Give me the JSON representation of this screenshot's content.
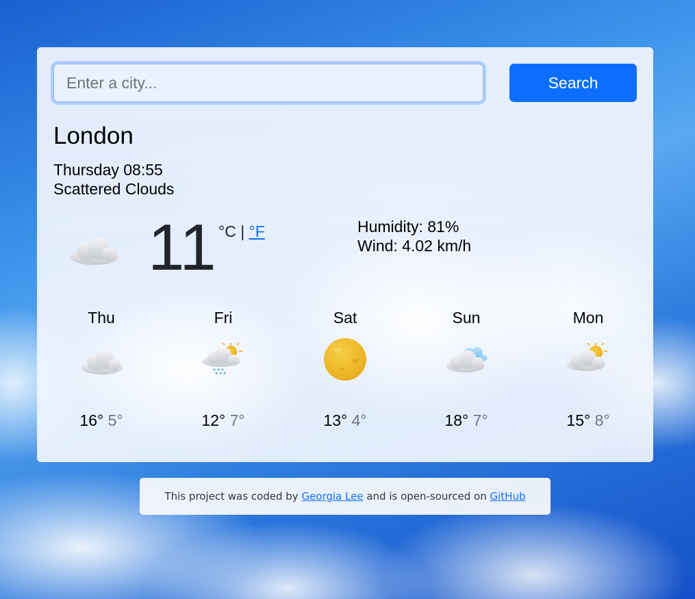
{
  "search": {
    "placeholder": "Enter a city...",
    "button_label": "Search"
  },
  "current": {
    "city": "London",
    "datetime": "Thursday 08:55",
    "description": "Scattered Clouds",
    "icon": "cloud-icon",
    "temperature": "11",
    "unit_celsius": "°C",
    "unit_separator": " | ",
    "unit_fahrenheit": "°F",
    "humidity": "Humidity: 81%",
    "wind": "Wind: 4.02 km/h"
  },
  "forecast": [
    {
      "day": "Thu",
      "icon": "cloud-icon",
      "max": "16°",
      "min": "5°"
    },
    {
      "day": "Fri",
      "icon": "rain-sun-cloud-icon",
      "max": "12°",
      "min": "7°"
    },
    {
      "day": "Sat",
      "icon": "sun-icon",
      "max": "13°",
      "min": "4°"
    },
    {
      "day": "Sun",
      "icon": "clouds-icon",
      "max": "18°",
      "min": "7°"
    },
    {
      "day": "Mon",
      "icon": "partly-cloudy-icon",
      "max": "15°",
      "min": "8°"
    }
  ],
  "footer": {
    "text_1": "This project was coded by ",
    "author": "Georgia Lee",
    "text_2": " and is open-sourced on ",
    "repo": "GitHub"
  },
  "colors": {
    "accent": "#0d6efd",
    "sun": "#f2b728",
    "cloud": "#d9dbe0"
  }
}
